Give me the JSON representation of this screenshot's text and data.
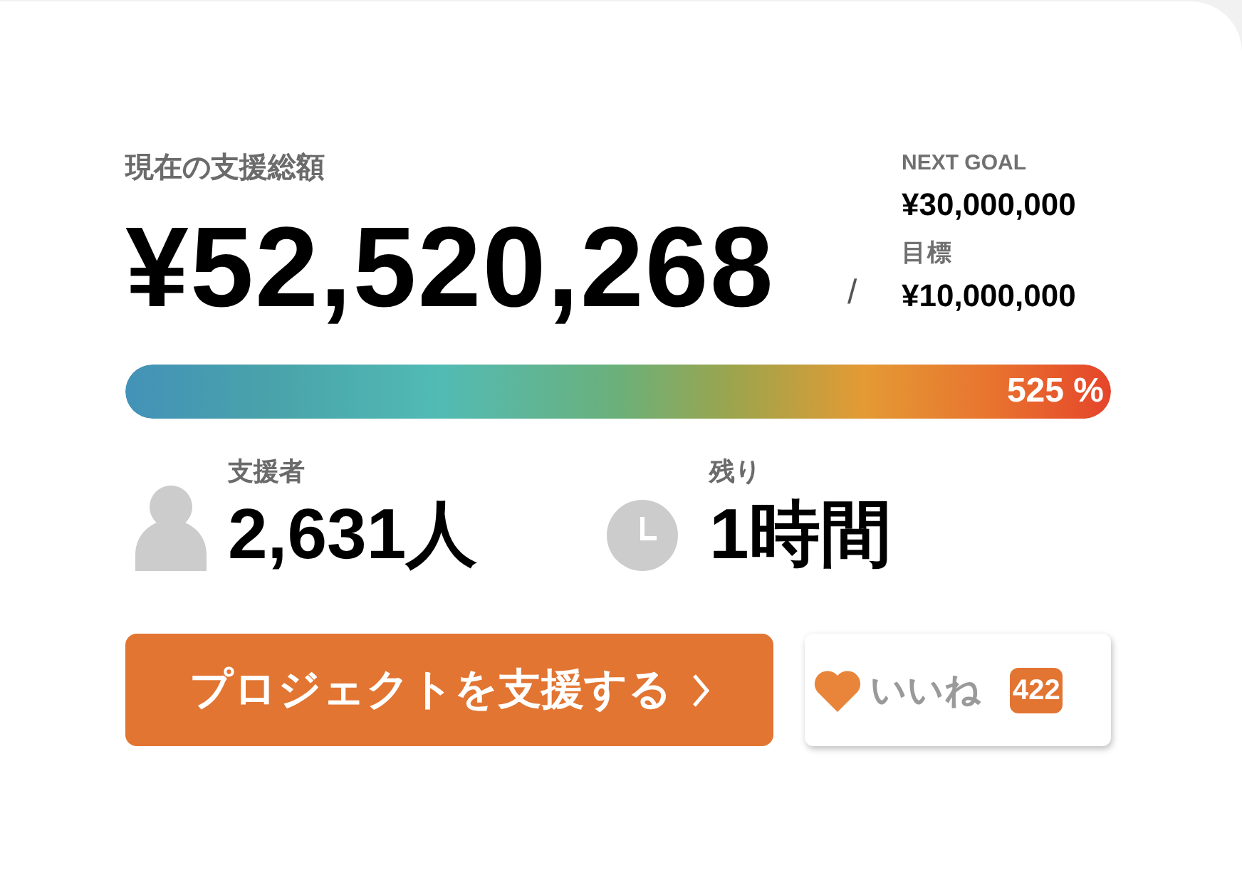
{
  "funding": {
    "label": "現在の支援総額",
    "amount": "¥52,520,268",
    "separator": "/",
    "goals": [
      {
        "kind": "next",
        "label": "NEXT GOAL",
        "amount": "¥30,000,000"
      },
      {
        "kind": "target",
        "label": "目標",
        "amount": "¥10,000,000"
      }
    ]
  },
  "progress": {
    "level": 1,
    "percent": "525 %"
  },
  "stats": [
    {
      "kind": "supporters",
      "label": "支援者",
      "value": "2,631人"
    },
    {
      "kind": "time_left",
      "label": "残り",
      "value": "1時間"
    }
  ],
  "actions": {
    "support_button": {
      "label": "プロジェクトを支援する"
    },
    "like_button": {
      "label": "いいね",
      "count": "422"
    }
  }
}
